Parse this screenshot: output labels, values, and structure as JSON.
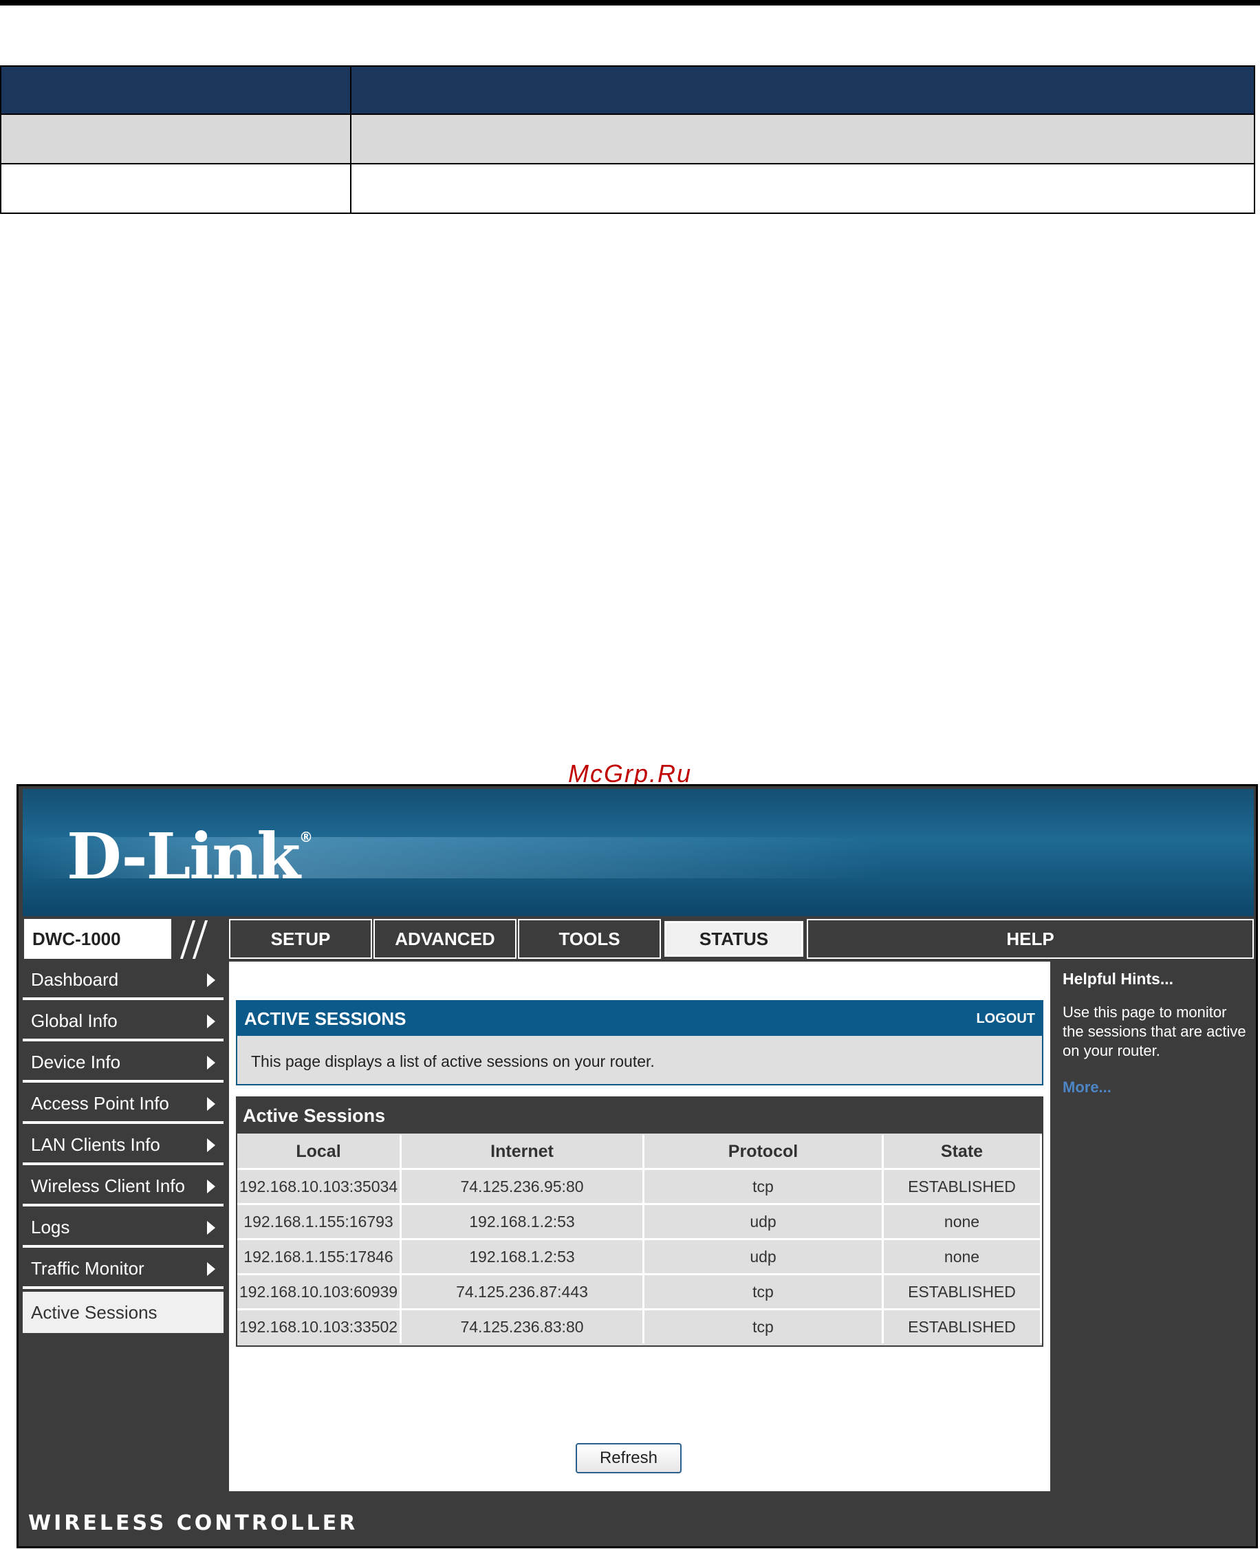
{
  "watermark": "McGrp.Ru",
  "brand": {
    "logo": "D-Link",
    "registered": "®"
  },
  "nav": {
    "model": "DWC-1000",
    "tabs": [
      {
        "label": "SETUP",
        "active": false
      },
      {
        "label": "ADVANCED",
        "active": false
      },
      {
        "label": "TOOLS",
        "active": false
      },
      {
        "label": "STATUS",
        "active": true
      },
      {
        "label": "HELP",
        "active": false
      }
    ]
  },
  "sidebar": {
    "items": [
      {
        "label": "Dashboard",
        "icon": "chevron-right-icon"
      },
      {
        "label": "Global Info",
        "icon": "chevron-right-icon"
      },
      {
        "label": "Device Info",
        "icon": "chevron-right-icon"
      },
      {
        "label": "Access Point Info",
        "icon": "chevron-right-icon"
      },
      {
        "label": "LAN Clients Info",
        "icon": "chevron-right-icon"
      },
      {
        "label": "Wireless Client Info",
        "icon": "chevron-right-icon"
      },
      {
        "label": "Logs",
        "icon": "chevron-right-icon"
      },
      {
        "label": "Traffic Monitor",
        "icon": "chevron-right-icon"
      },
      {
        "label": "Active Sessions",
        "active": true
      }
    ]
  },
  "main": {
    "title": "ACTIVE SESSIONS",
    "logout": "LOGOUT",
    "description": "This page displays a list of active sessions on your router.",
    "sessions_title": "Active Sessions",
    "columns": [
      "Local",
      "Internet",
      "Protocol",
      "State"
    ],
    "rows": [
      [
        "192.168.10.103:35034",
        "74.125.236.95:80",
        "tcp",
        "ESTABLISHED"
      ],
      [
        "192.168.1.155:16793",
        "192.168.1.2:53",
        "udp",
        "none"
      ],
      [
        "192.168.1.155:17846",
        "192.168.1.2:53",
        "udp",
        "none"
      ],
      [
        "192.168.10.103:60939",
        "74.125.236.87:443",
        "tcp",
        "ESTABLISHED"
      ],
      [
        "192.168.10.103:33502",
        "74.125.236.83:80",
        "tcp",
        "ESTABLISHED"
      ]
    ],
    "refresh": "Refresh"
  },
  "help": {
    "title": "Helpful Hints...",
    "text": "Use this page to monitor the sessions that are active on your router.",
    "more": "More..."
  },
  "footer": {
    "text": "WIRELESS CONTROLLER"
  },
  "colors": {
    "header_blue": "#0b5a8a",
    "dark_gray": "#3c3c3c",
    "table_navy": "#1a365d"
  }
}
